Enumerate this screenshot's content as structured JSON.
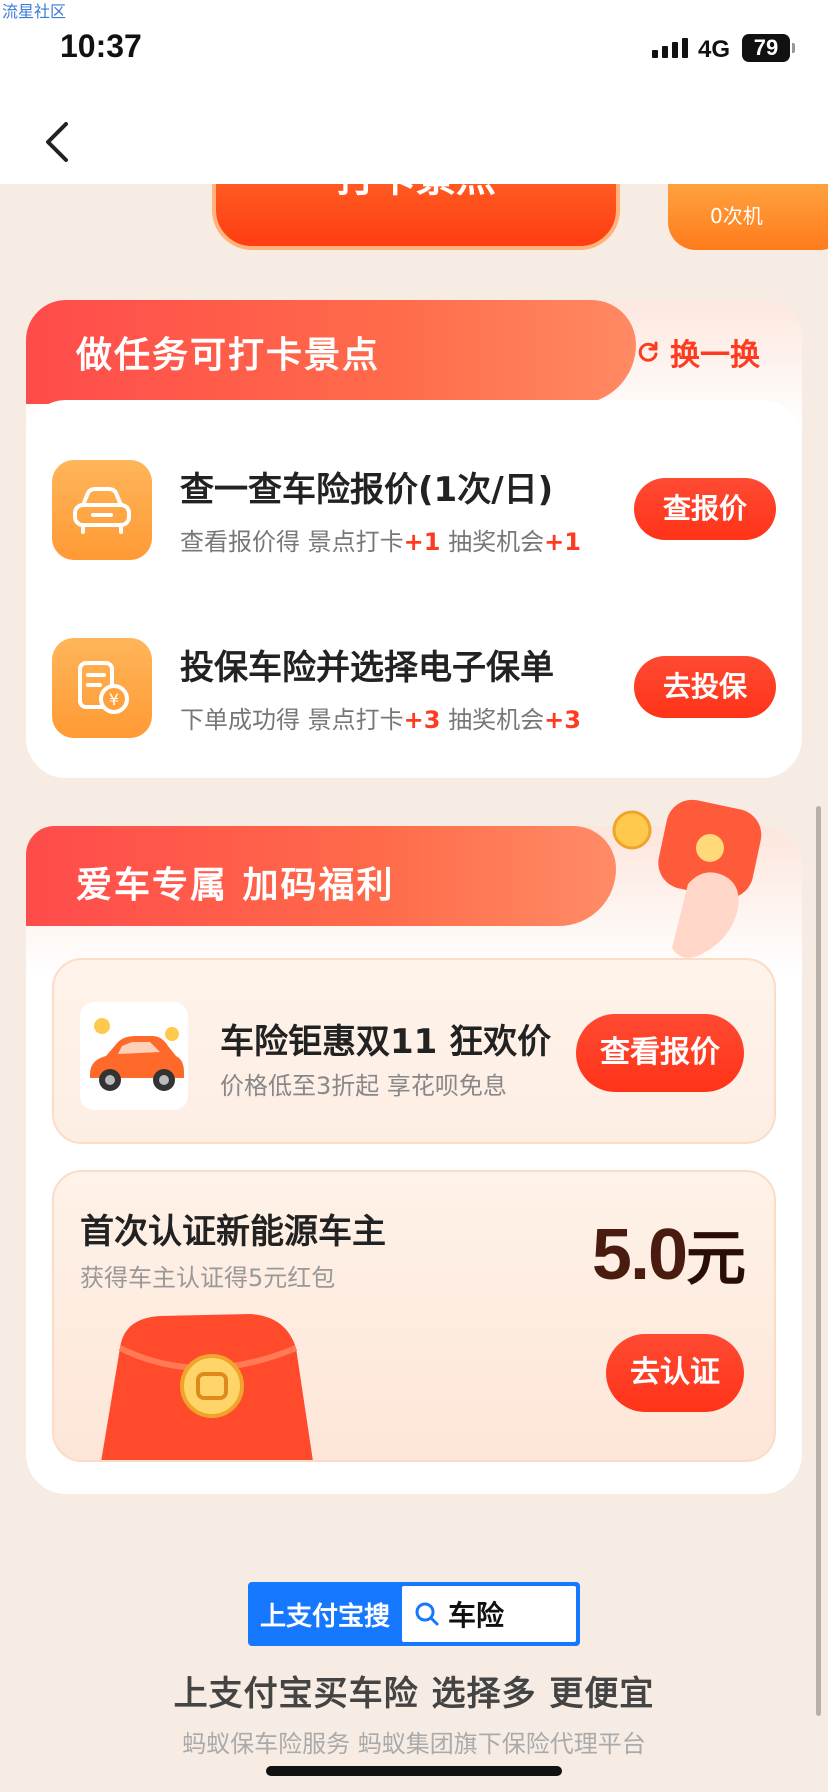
{
  "watermark": "流星社区",
  "status": {
    "time": "10:37",
    "network": "4G",
    "battery": "79"
  },
  "top": {
    "checkin_label": "打卡景点",
    "side_text": "0次机"
  },
  "tasks_card": {
    "title": "做任务可打卡景点",
    "refresh_label": "换一换",
    "items": [
      {
        "title": "查一查车险报价(1次/日)",
        "sub_prefix": "查看报价得 景点打卡",
        "sub_bonus1": "+1",
        "sub_mid": " 抽奖机会",
        "sub_bonus2": "+1",
        "button": "查报价"
      },
      {
        "title": "投保车险并选择电子保单",
        "sub_prefix": "下单成功得 景点打卡",
        "sub_bonus1": "+3",
        "sub_mid": " 抽奖机会",
        "sub_bonus2": "+3",
        "button": "去投保"
      }
    ]
  },
  "benefit_card": {
    "title": "爱车专属 加码福利",
    "promo": {
      "title": "车险钜惠双11 狂欢价",
      "sub": "价格低至3折起 享花呗免息",
      "button": "查看报价"
    },
    "cert": {
      "title": "首次认证新能源车主",
      "sub": "获得车主认证得5元红包",
      "amount": "5.0",
      "unit": "元",
      "button": "去认证"
    }
  },
  "search_banner": {
    "label": "上支付宝搜",
    "query": "车险"
  },
  "footer": {
    "slogan": "上支付宝买车险 选择多 更便宜",
    "note": "蚂蚁保车险服务 蚂蚁集团旗下保险代理平台"
  },
  "colors": {
    "accent": "#ff3b1f",
    "brand_blue": "#1677ff",
    "icon_orange": "#ffa13d"
  }
}
